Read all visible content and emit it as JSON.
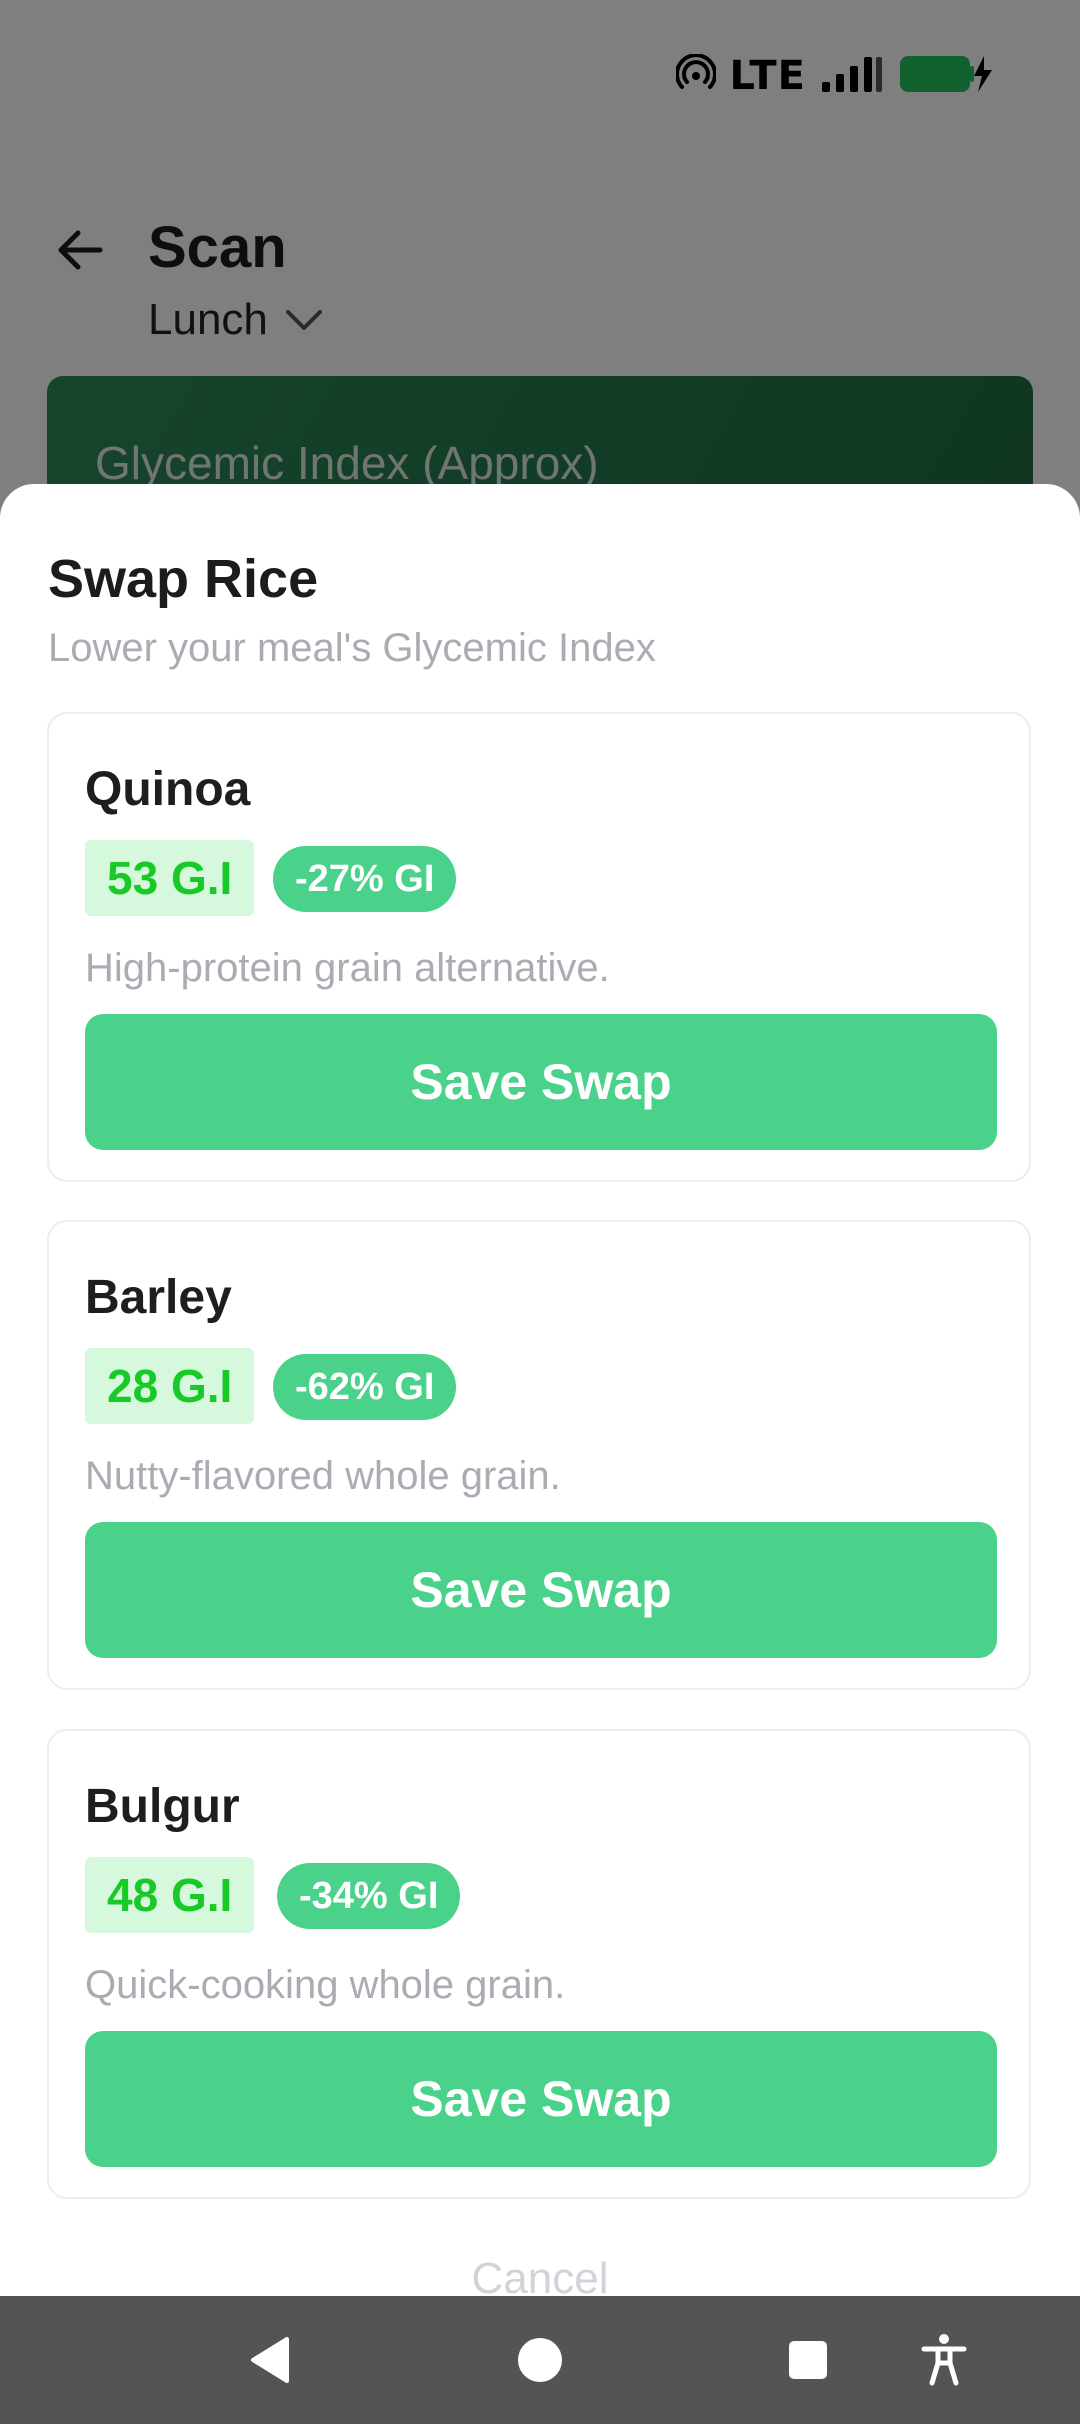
{
  "status_bar": {
    "network": "LTE",
    "battery_color": "#22c55e"
  },
  "header": {
    "title": "Scan",
    "meal": "Lunch"
  },
  "banner": {
    "title": "Glycemic Index (Approx)"
  },
  "sheet": {
    "title": "Swap Rice",
    "subtitle": "Lower your meal's Glycemic Index",
    "cards": [
      {
        "name": "Quinoa",
        "gi": "53 G.I",
        "change": "-27% GI",
        "description": "High-protein grain alternative.",
        "button": "Save Swap"
      },
      {
        "name": "Barley",
        "gi": "28 G.I",
        "change": "-62% GI",
        "description": "Nutty-flavored whole grain.",
        "button": "Save Swap"
      },
      {
        "name": "Bulgur",
        "gi": "48 G.I",
        "change": "-34% GI",
        "description": "Quick-cooking whole grain.",
        "button": "Save Swap"
      }
    ],
    "cancel": "Cancel"
  },
  "colors": {
    "accent": "#4ad28a",
    "gi_text": "#19c928",
    "gi_chip_bg": "#d6f8dc",
    "banner": "#247a4c"
  }
}
